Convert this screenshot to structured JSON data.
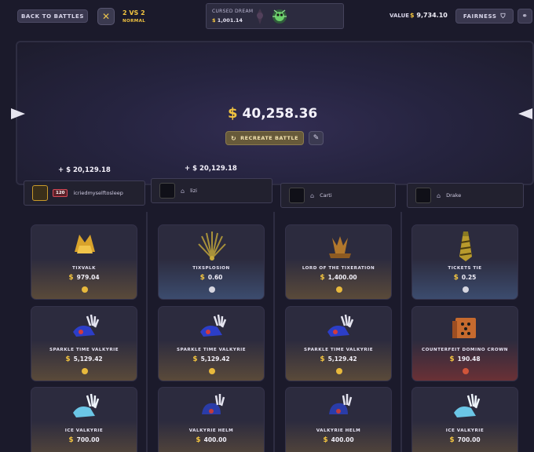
{
  "header": {
    "back_label": "BACK TO BATTLES",
    "mode": "2 VS 2",
    "mode_sub": "NORMAL",
    "case_name": "CURSED DREAM",
    "case_price": "1,001.14",
    "value_label": "VALUE",
    "value_amount": "9,734.10",
    "fairness_label": "FAIRNESS",
    "coin_symbol": "$",
    "icons": [
      "swords-icon",
      "shield-check-icon",
      "link-icon"
    ]
  },
  "stage": {
    "total": "40,258.36",
    "recreate_label": "RECREATE BATTLE"
  },
  "teams": [
    {
      "winnings": "+ $ 20,129.18"
    },
    {
      "winnings": "+ $ 20,129.18"
    }
  ],
  "players": [
    {
      "name": "icriedmyselftosleep",
      "level": "120"
    },
    {
      "name": "lizi"
    },
    {
      "name": "Carti"
    },
    {
      "name": "Drake"
    }
  ],
  "items": [
    [
      {
        "name": "TIXVALK",
        "price": "979.04"
      },
      {
        "name": "SPARKLE TIME VALKYRIE",
        "price": "5,129.42"
      },
      {
        "name": "ICE VALKYRIE",
        "price": "700.00"
      }
    ],
    [
      {
        "name": "TIXSPLOSION",
        "price": "0.60"
      },
      {
        "name": "SPARKLE TIME VALKYRIE",
        "price": "5,129.42"
      },
      {
        "name": "VALKYRIE HELM",
        "price": "400.00"
      }
    ],
    [
      {
        "name": "LORD OF THE TIXERATION",
        "price": "1,400.00"
      },
      {
        "name": "SPARKLE TIME VALKYRIE",
        "price": "5,129.42"
      },
      {
        "name": "VALKYRIE HELM",
        "price": "400.00"
      }
    ],
    [
      {
        "name": "TICKETS TIE",
        "price": "0.25"
      },
      {
        "name": "COUNTERFEIT DOMINO CROWN",
        "price": "190.48"
      },
      {
        "name": "ICE VALKYRIE",
        "price": "700.00"
      }
    ]
  ]
}
